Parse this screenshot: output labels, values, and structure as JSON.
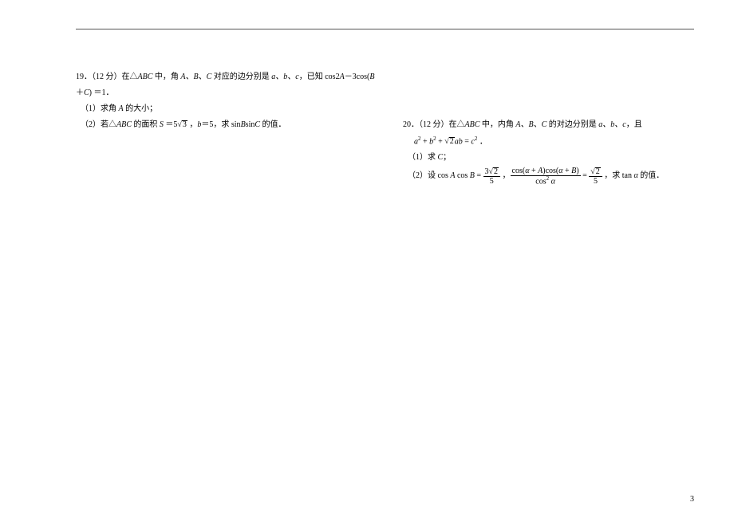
{
  "q19": {
    "number": "19",
    "points": "（12 分）",
    "heading_pre": "在△",
    "triangle": "ABC",
    "heading_mid": " 中，角 ",
    "angles": "A、B、C",
    "heading_obj": " 对应的边分别是 ",
    "sides": "a、b、c",
    "heading_given": "，已知 cos2",
    "ang_a": "A",
    "heading_rhs": "－3cos(",
    "ang_b": "B",
    "heading_line2": "＋",
    "ang_c": "C",
    "heading_eq": ") ＝1．",
    "sub1": "（1）求角 ",
    "sub1_ang": "A",
    "sub1_tail": " 的大小；",
    "sub2_pre": "（2）若△",
    "sub2_tri": "ABC",
    "sub2_area": " 的面积 ",
    "area_sym": "S",
    "eq1": " ＝5",
    "rad_v1": "3",
    "sub2_mid": " ，",
    "var_b": "b",
    "eq2": "＝5，求 sin",
    "var_B": "B",
    "sin_txt": "sin",
    "var_C": "C",
    "sub2_tail": " 的值．"
  },
  "q20": {
    "number": "20",
    "points": "（12 分）",
    "heading_pre": "在△",
    "triangle": "ABC",
    "heading_mid": " 中，内角 ",
    "angles": "A、B、C",
    "heading_obj": " 的对边分别是 ",
    "sides": "a、b、c",
    "heading_tail": "，且",
    "eq_a": "a",
    "eq_plus1": " + ",
    "eq_b": "b",
    "eq_plus2": " + ",
    "rad_v1": "2",
    "eq_ab": "ab",
    "eq_eq": " = ",
    "eq_c": "c",
    "eq_dot": " ．",
    "sub1": "（1）求 ",
    "sub1_c": "C",
    "sub1_tail": "；",
    "sub2_pre": "（2）设 cos ",
    "var_A": "A",
    "cos_txt": " cos ",
    "var_B": "B",
    "eq_sym": " = ",
    "frac1_num": "3",
    "rad_v2": "2",
    "frac1_den": "5",
    "comma": " ，",
    "num_cos": "cos",
    "alpha": "α",
    "num_plus": " + ",
    "frac2_den_pre": "cos",
    "frac2_den_sup": "2",
    "eq2_sym": " = ",
    "rad_v3": "2",
    "frac3_den": "5",
    "sub2_tail": " ，求 tan ",
    "var_alpha": "α",
    "sub2_end": " 的值．"
  },
  "footer": "3"
}
